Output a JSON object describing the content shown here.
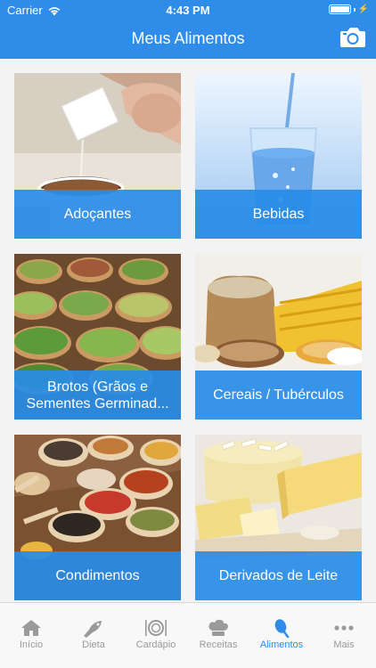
{
  "status_bar": {
    "carrier": "Carrier",
    "time": "4:43 PM",
    "battery_level": 1.0
  },
  "nav": {
    "title": "Meus Alimentos",
    "camera_icon": "camera-icon"
  },
  "categories": [
    {
      "label": "Adoçantes",
      "image": "sweetener-photo"
    },
    {
      "label": "Bebidas",
      "image": "water-glass-photo"
    },
    {
      "label": "Brotos (Grãos e Sementes Germinad...",
      "image": "sprouts-bowls-photo"
    },
    {
      "label": "Cereais / Tubérculos",
      "image": "cereals-sacks-photo"
    },
    {
      "label": "Condimentos",
      "image": "spices-spoons-photo"
    },
    {
      "label": "Derivados de Leite",
      "image": "cheese-photo"
    }
  ],
  "tabs": [
    {
      "label": "Início",
      "icon": "home-icon",
      "active": false
    },
    {
      "label": "Dieta",
      "icon": "fish-icon",
      "active": false
    },
    {
      "label": "Cardápio",
      "icon": "plate-icon",
      "active": false
    },
    {
      "label": "Receitas",
      "icon": "chef-hat-icon",
      "active": false
    },
    {
      "label": "Alimentos",
      "icon": "food-icon",
      "active": true
    },
    {
      "label": "Mais",
      "icon": "more-icon",
      "active": false
    }
  ],
  "colors": {
    "primary": "#2f8ce8",
    "tab_inactive": "#9a9a9a"
  }
}
